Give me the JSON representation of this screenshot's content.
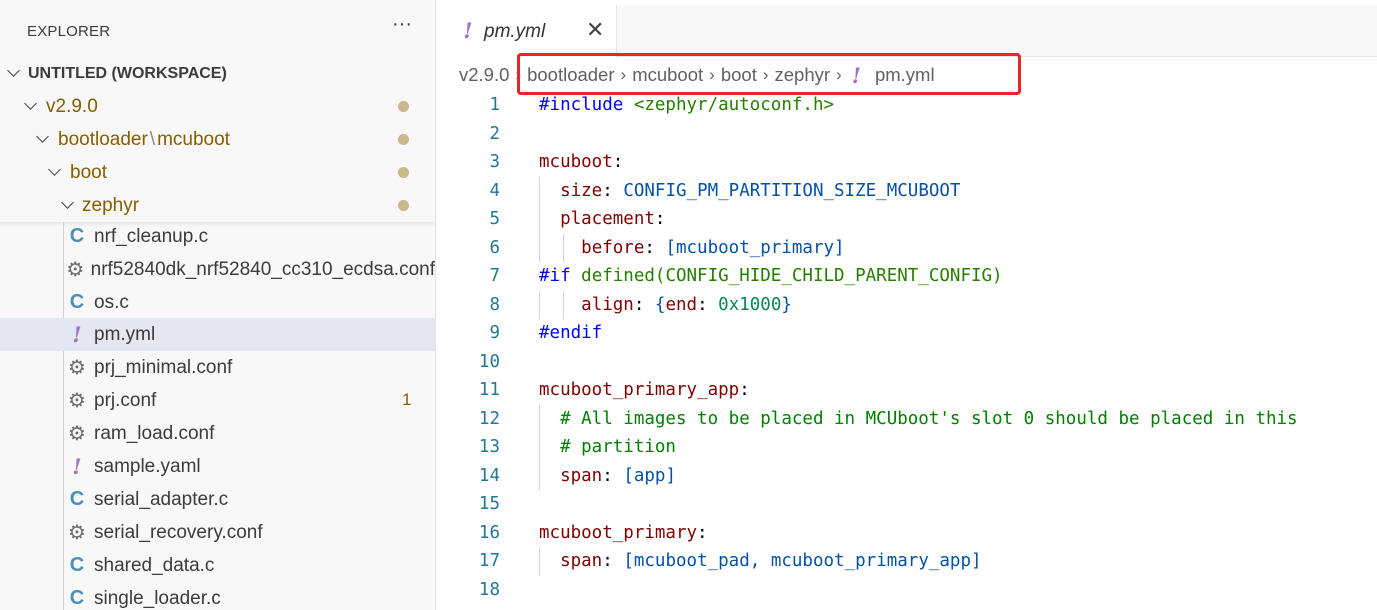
{
  "sidebar": {
    "title": "EXPLORER",
    "more": "···",
    "workspace": "UNTITLED (WORKSPACE)",
    "folders": [
      {
        "label": "v2.9.0"
      },
      {
        "label_a": "bootloader",
        "sep": "\\",
        "label_b": "mcuboot"
      },
      {
        "label": "boot"
      },
      {
        "label": "zephyr"
      }
    ],
    "files": [
      {
        "label": "nrf_cleanup.c",
        "icon": "c-icon",
        "glyph": "C"
      },
      {
        "label": "nrf52840dk_nrf52840_cc310_ecdsa.conf",
        "icon": "gear-icon",
        "glyph": "⚙"
      },
      {
        "label": "os.c",
        "icon": "c-icon",
        "glyph": "C"
      },
      {
        "label": "pm.yml",
        "icon": "yaml-icon",
        "glyph": "!"
      },
      {
        "label": "prj_minimal.conf",
        "icon": "gear-icon",
        "glyph": "⚙"
      },
      {
        "label": "prj.conf",
        "icon": "gear-icon",
        "glyph": "⚙",
        "badge": "1"
      },
      {
        "label": "ram_load.conf",
        "icon": "gear-icon",
        "glyph": "⚙"
      },
      {
        "label": "sample.yaml",
        "icon": "yaml-icon",
        "glyph": "!"
      },
      {
        "label": "serial_adapter.c",
        "icon": "c-icon",
        "glyph": "C"
      },
      {
        "label": "serial_recovery.conf",
        "icon": "gear-icon",
        "glyph": "⚙"
      },
      {
        "label": "shared_data.c",
        "icon": "c-icon",
        "glyph": "C"
      },
      {
        "label": "single_loader.c",
        "icon": "c-icon",
        "glyph": "C"
      }
    ]
  },
  "tab": {
    "label": "pm.yml",
    "glyph": "!",
    "close": "✕"
  },
  "breadcrumb": {
    "items": [
      "v2.9.0",
      "bootloader",
      "mcuboot",
      "boot",
      "zephyr"
    ],
    "file": "pm.yml",
    "file_glyph": "!",
    "sep": "›"
  },
  "code": {
    "lines": [
      {
        "n": "1",
        "parts": [
          [
            "c-pre",
            "#include "
          ],
          [
            "c-inc",
            "<zephyr/autoconf.h>"
          ]
        ]
      },
      {
        "n": "2",
        "parts": []
      },
      {
        "n": "3",
        "parts": [
          [
            "c-key",
            "mcuboot"
          ],
          [
            "c-pun",
            ":"
          ]
        ]
      },
      {
        "n": "4",
        "parts": [
          [
            "c-pun",
            "  "
          ],
          [
            "c-key",
            "size"
          ],
          [
            "c-pun",
            ": "
          ],
          [
            "c-val",
            "CONFIG_PM_PARTITION_SIZE_MCUBOOT"
          ]
        ]
      },
      {
        "n": "5",
        "parts": [
          [
            "c-pun",
            "  "
          ],
          [
            "c-key",
            "placement"
          ],
          [
            "c-pun",
            ":"
          ]
        ]
      },
      {
        "n": "6",
        "parts": [
          [
            "c-pun",
            "    "
          ],
          [
            "c-key",
            "before"
          ],
          [
            "c-pun",
            ": "
          ],
          [
            "c-val",
            "[mcuboot_primary]"
          ]
        ]
      },
      {
        "n": "7",
        "parts": [
          [
            "c-dir",
            "#if "
          ],
          [
            "c-inc",
            "defined(CONFIG_HIDE_CHILD_PARENT_CONFIG)"
          ]
        ]
      },
      {
        "n": "8",
        "parts": [
          [
            "c-pun",
            "    "
          ],
          [
            "c-key",
            "align"
          ],
          [
            "c-pun",
            ": "
          ],
          [
            "c-val",
            "{"
          ],
          [
            "c-key",
            "end"
          ],
          [
            "c-pun",
            ": "
          ],
          [
            "c-num",
            "0x1000"
          ],
          [
            "c-val",
            "}"
          ]
        ]
      },
      {
        "n": "9",
        "parts": [
          [
            "c-dir",
            "#endif"
          ]
        ]
      },
      {
        "n": "10",
        "parts": []
      },
      {
        "n": "11",
        "parts": [
          [
            "c-key",
            "mcuboot_primary_app"
          ],
          [
            "c-pun",
            ":"
          ]
        ]
      },
      {
        "n": "12",
        "parts": [
          [
            "c-pun",
            "  "
          ],
          [
            "c-com",
            "# All images to be placed in MCUboot's slot 0 should be placed in this"
          ]
        ]
      },
      {
        "n": "13",
        "parts": [
          [
            "c-pun",
            "  "
          ],
          [
            "c-com",
            "# partition"
          ]
        ]
      },
      {
        "n": "14",
        "parts": [
          [
            "c-pun",
            "  "
          ],
          [
            "c-key",
            "span"
          ],
          [
            "c-pun",
            ": "
          ],
          [
            "c-val",
            "[app]"
          ]
        ]
      },
      {
        "n": "15",
        "parts": []
      },
      {
        "n": "16",
        "parts": [
          [
            "c-key",
            "mcuboot_primary"
          ],
          [
            "c-pun",
            ":"
          ]
        ]
      },
      {
        "n": "17",
        "parts": [
          [
            "c-pun",
            "  "
          ],
          [
            "c-key",
            "span"
          ],
          [
            "c-pun",
            ": "
          ],
          [
            "c-val",
            "[mcuboot_pad, mcuboot_primary_app]"
          ]
        ]
      },
      {
        "n": "18",
        "parts": []
      }
    ]
  },
  "colors": {
    "highlight": "#e8262a",
    "modified": "#855f00",
    "selected_row": "#e4e6f1"
  }
}
